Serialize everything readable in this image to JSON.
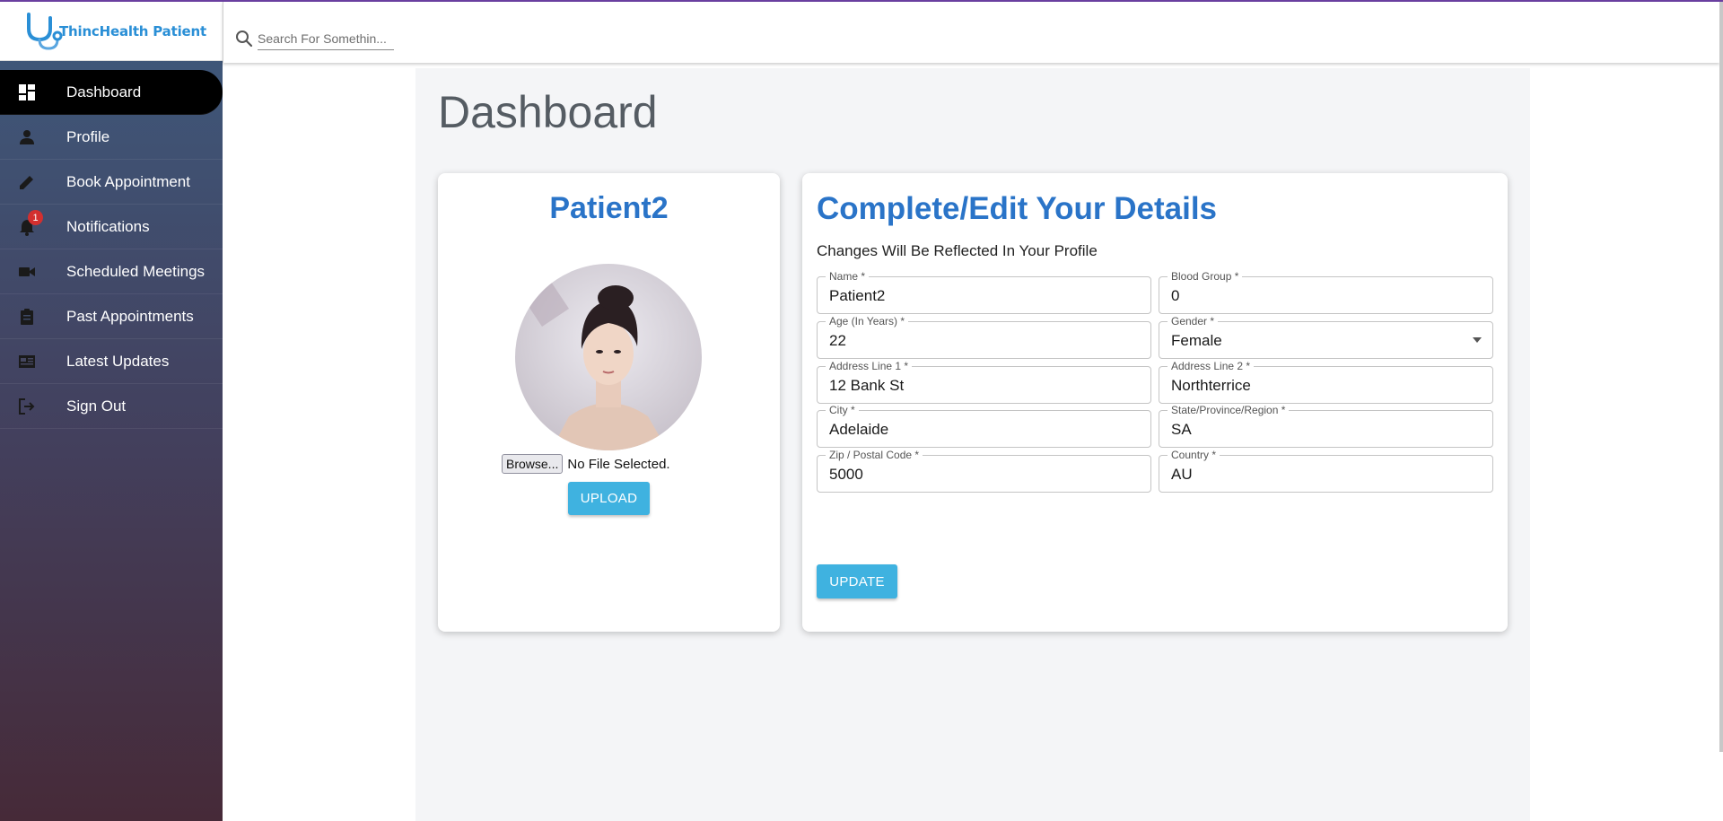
{
  "app": {
    "logo_text": "ThincHealth Patient",
    "brand_color": "#2a8fd6",
    "accent_color": "#3fb2e0",
    "title_color": "#2a74c8"
  },
  "search": {
    "placeholder": "Search For Somethin..."
  },
  "sidebar": {
    "items": [
      {
        "label": "Dashboard",
        "icon": "dashboard-icon",
        "active": true
      },
      {
        "label": "Profile",
        "icon": "person-icon"
      },
      {
        "label": "Book Appointment",
        "icon": "pencil-icon"
      },
      {
        "label": "Notifications",
        "icon": "bell-icon",
        "badge": "1"
      },
      {
        "label": "Scheduled Meetings",
        "icon": "videocam-icon"
      },
      {
        "label": "Past Appointments",
        "icon": "clipboard-icon"
      },
      {
        "label": "Latest Updates",
        "icon": "newspaper-icon"
      },
      {
        "label": "Sign Out",
        "icon": "sign-out-icon"
      }
    ]
  },
  "main": {
    "title": "Dashboard",
    "profile_card": {
      "name": "Patient2",
      "browse_label": "Browse...",
      "file_status": "No File Selected.",
      "upload_label": "UPLOAD"
    },
    "details_card": {
      "title": "Complete/Edit Your Details",
      "subtitle": "Changes Will Be Reflected In Your Profile",
      "fields": [
        {
          "label": "Name *",
          "value": "Patient2"
        },
        {
          "label": "Blood Group *",
          "value": "0"
        },
        {
          "label": "Age (In Years) *",
          "value": "22"
        },
        {
          "label": "Gender *",
          "value": "Female"
        },
        {
          "label": "Address Line 1 *",
          "value": "12 Bank St"
        },
        {
          "label": "Address Line 2 *",
          "value": "Northterrice"
        },
        {
          "label": "City *",
          "value": "Adelaide"
        },
        {
          "label": "State/Province/Region *",
          "value": "SA"
        },
        {
          "label": "Zip / Postal Code *",
          "value": "5000"
        },
        {
          "label": "Country *",
          "value": "AU"
        }
      ],
      "update_label": "UPDATE"
    }
  }
}
